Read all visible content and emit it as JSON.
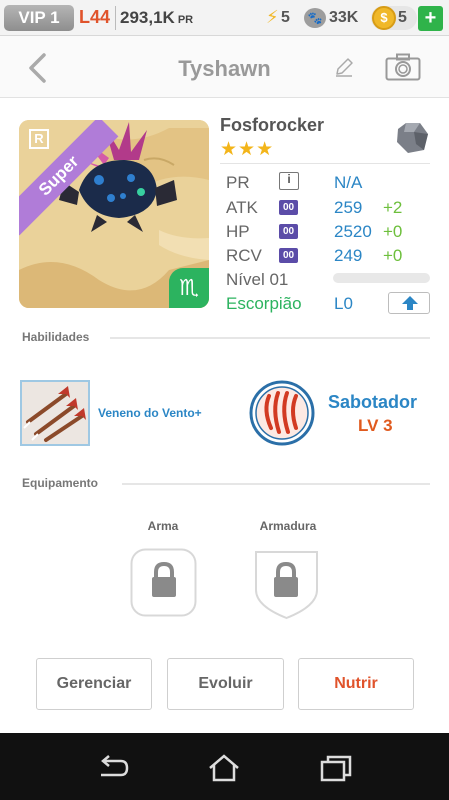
{
  "status": {
    "vip": "VIP 1",
    "level": "L44",
    "power": "293,1K",
    "power_unit": "PR",
    "energy": "5",
    "paw": "33K",
    "coins": "5",
    "plus": "+"
  },
  "header": {
    "title": "Tyshawn"
  },
  "monster": {
    "rarity_letter": "R",
    "rarity_badge": "Super",
    "name": "Fosforocker",
    "stars": "★★★",
    "element_icon": "rock-element-icon",
    "zodiac_symbol": "♏",
    "stats": [
      {
        "label": "PR",
        "icon": "i",
        "value": "N/A",
        "bonus": ""
      },
      {
        "label": "ATK",
        "icon": "00",
        "value": "259",
        "bonus": "+2"
      },
      {
        "label": "HP",
        "icon": "00",
        "value": "2520",
        "bonus": "+0"
      },
      {
        "label": "RCV",
        "icon": "00",
        "value": "249",
        "bonus": "+0"
      }
    ],
    "nivel_label": "Nível 01",
    "nivel_progress": 0,
    "zodiac_name": "Escorpião",
    "zodiac_level": "L0"
  },
  "skills": {
    "section_label": "Habilidades",
    "skill_name": "Veneno do Vento+",
    "ability_name": "Sabotador",
    "ability_level": "LV 3"
  },
  "equipment": {
    "section_label": "Equipamento",
    "weapon_label": "Arma",
    "armor_label": "Armadura"
  },
  "actions": {
    "manage": "Gerenciar",
    "evolve": "Evoluir",
    "feed": "Nutrir"
  },
  "colors": {
    "accent_blue": "#2b86c5",
    "bonus_green": "#6dbf3c",
    "warn_orange": "#e05a1e",
    "zodiac_green": "#2cb35f",
    "star_gold": "#f3b51a"
  }
}
